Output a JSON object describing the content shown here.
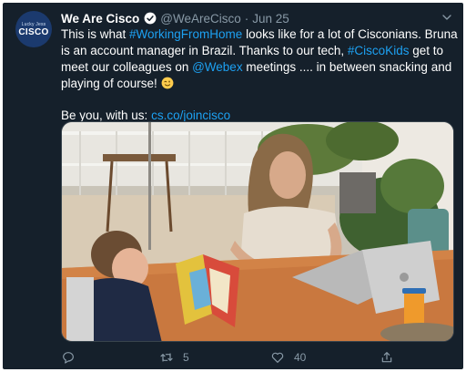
{
  "tweet": {
    "avatar": {
      "small_text": "Lucky Jess",
      "big_text": "CISCO"
    },
    "display_name": "We Are Cisco",
    "handle": "@WeAreCisco",
    "separator": "·",
    "date": "Jun 25",
    "body": {
      "l1_a": "This is what ",
      "l1_hashtag": "#WorkingFromHome",
      "l1_b": " looks like for a lot of Cisconians. Bruna",
      "l2_a": "is an account manager in Brazil. Thanks to our tech, ",
      "l2_hashtag": "#CiscoKids",
      "l2_b": " get to",
      "l3_a": "meet our colleagues on ",
      "l3_mention": "@Webex",
      "l3_b": " meetings .... in between snacking and",
      "l4_a": "playing of course! ",
      "l5_a": "Be you, with us: ",
      "l5_link": "cs.co/joincisco"
    },
    "icons": {
      "verified": "verified-badge-icon",
      "emoji": "winking-face-emoji",
      "more": "chevron-down-icon",
      "reply": "reply-icon",
      "retweet": "retweet-icon",
      "like": "heart-icon",
      "share": "share-icon"
    },
    "actions": {
      "reply_count": "",
      "retweet_count": "5",
      "like_count": "40"
    },
    "colors": {
      "background": "#15202b",
      "text": "#ffffff",
      "secondary": "#8899a6",
      "link": "#1da1f2"
    }
  }
}
